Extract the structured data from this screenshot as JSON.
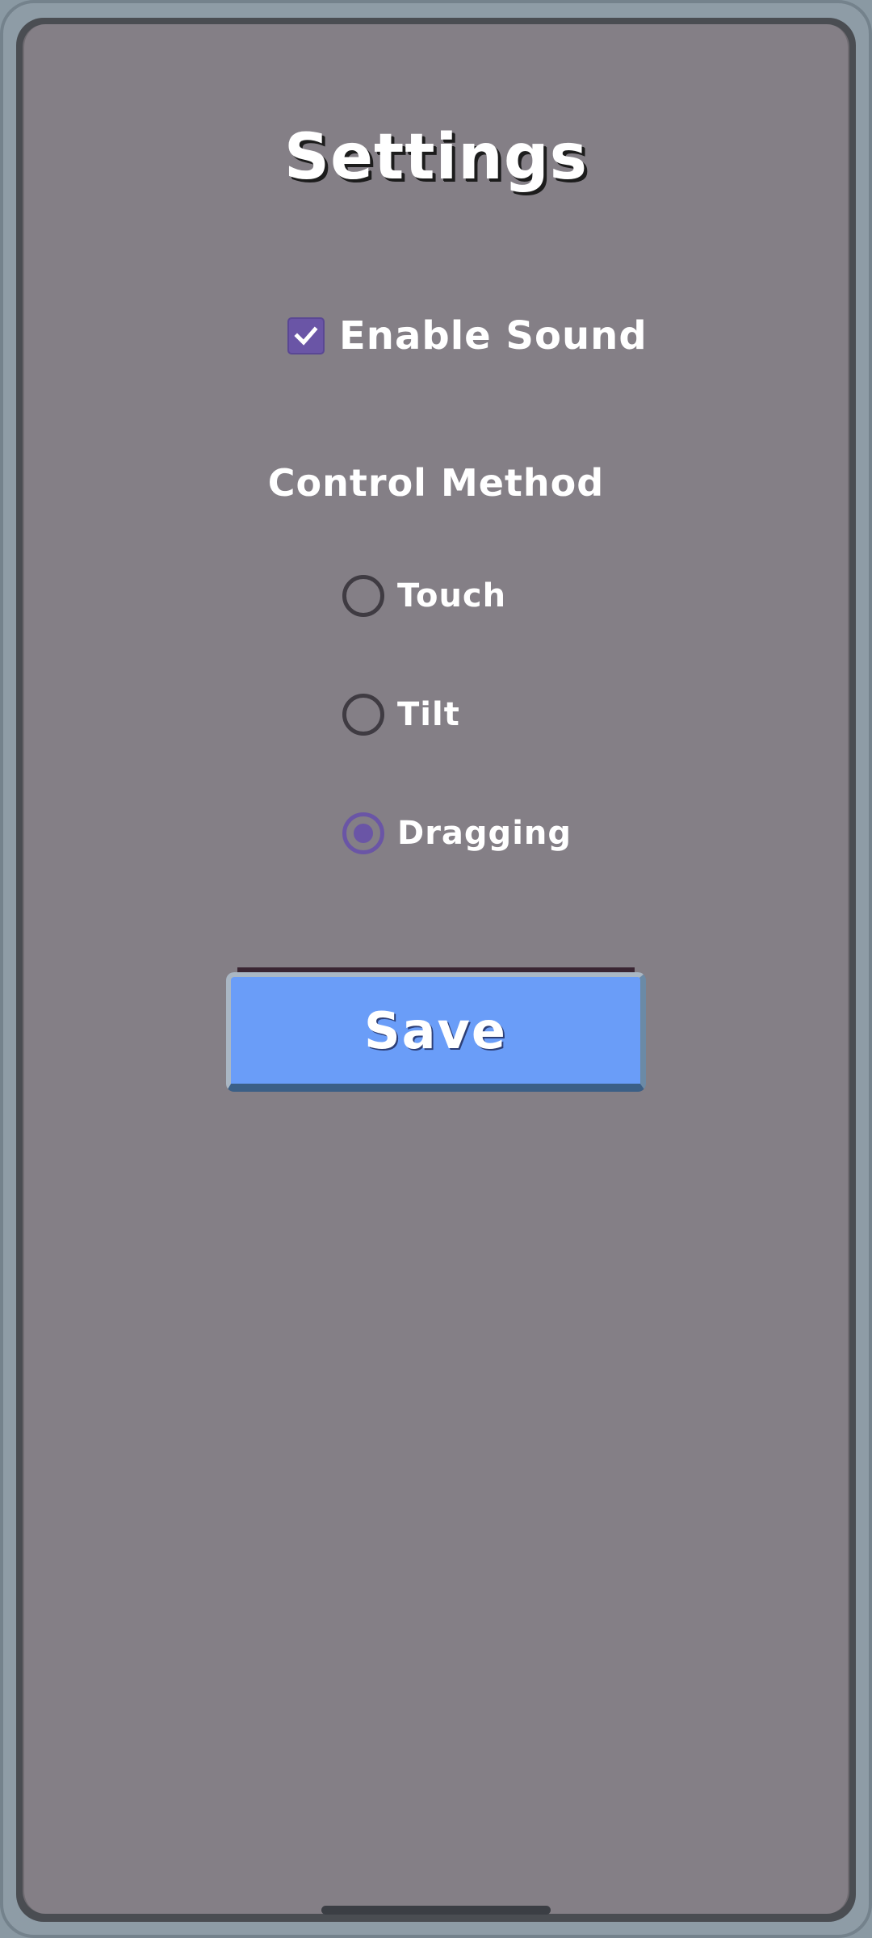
{
  "screen": {
    "title": "Settings"
  },
  "sound": {
    "label": "Enable Sound",
    "checked": true,
    "checkmark": "✓",
    "check_icon": "checkmark-icon"
  },
  "control_method": {
    "heading": "Control Method",
    "options": [
      {
        "label": "Touch",
        "selected": false
      },
      {
        "label": "Tilt",
        "selected": false
      },
      {
        "label": "Dragging",
        "selected": true
      }
    ]
  },
  "actions": {
    "save_label": "Save"
  },
  "colors": {
    "panel_background": "#847f86",
    "accent_purple": "#6a55a6",
    "button_blue": "#6a9df8",
    "text": "#ffffff"
  }
}
